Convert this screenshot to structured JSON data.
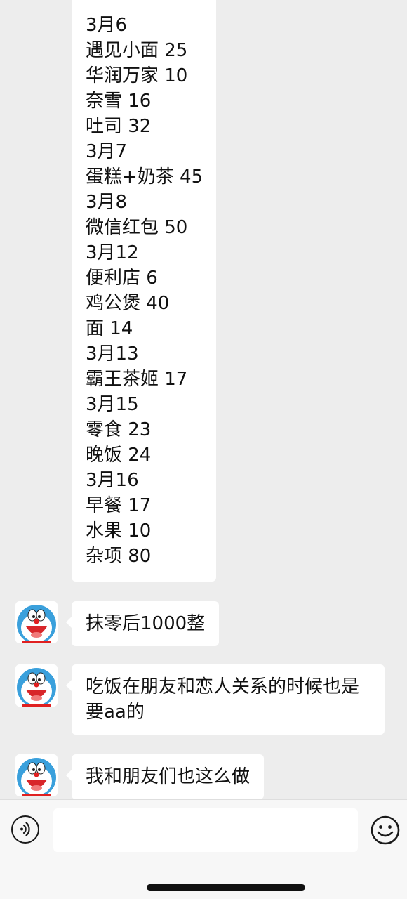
{
  "expense_list": {
    "lines": [
      "3月6",
      "遇见小面 25",
      "华润万家 10",
      "奈雪 16",
      "吐司 32",
      "3月7",
      "蛋糕+奶茶 45",
      "3月8",
      "微信红包 50",
      "3月12",
      "便利店 6",
      "鸡公煲 40",
      "面 14",
      "3月13",
      "霸王茶姬 17",
      "3月15",
      "零食 23",
      "晚饭 24",
      "3月16",
      "早餐 17",
      "水果 10",
      "杂项 80"
    ]
  },
  "messages": [
    {
      "line1": "抹零后1000整"
    },
    {
      "line1": "吃饭在朋友和恋人关系的时候也是",
      "line2": "要aa的"
    },
    {
      "line1": "我和朋友们也这么做"
    }
  ],
  "avatar": {
    "icon": "doraemon-avatar-icon"
  },
  "input_bar": {
    "input_value": "",
    "voice_icon": "voice-icon",
    "emoji_icon": "emoji-smile-icon"
  },
  "colors": {
    "background": "#ededed",
    "bubble": "#ffffff",
    "input_bar": "#f7f7f7"
  }
}
